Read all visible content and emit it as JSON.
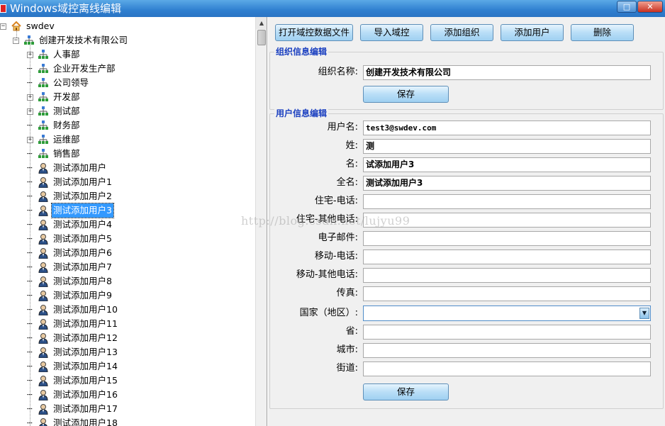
{
  "window": {
    "title": "Windows域控离线编辑",
    "maximize_glyph": "□",
    "close_glyph": "✕"
  },
  "tree": {
    "root": "swdev",
    "company": "创建开发技术有限公司",
    "departments": [
      {
        "label": "人事部",
        "expandable": true
      },
      {
        "label": "企业开发生产部",
        "expandable": false
      },
      {
        "label": "公司领导",
        "expandable": false
      },
      {
        "label": "开发部",
        "expandable": true
      },
      {
        "label": "测试部",
        "expandable": true
      },
      {
        "label": "财务部",
        "expandable": false
      },
      {
        "label": "运维部",
        "expandable": true
      },
      {
        "label": "销售部",
        "expandable": false
      }
    ],
    "users": [
      "测试添加用户",
      "测试添加用户1",
      "测试添加用户2",
      "测试添加用户3",
      "测试添加用户4",
      "测试添加用户5",
      "测试添加用户6",
      "测试添加用户7",
      "测试添加用户8",
      "测试添加用户9",
      "测试添加用户10",
      "测试添加用户11",
      "测试添加用户12",
      "测试添加用户13",
      "测试添加用户14",
      "测试添加用户15",
      "测试添加用户16",
      "测试添加用户17",
      "测试添加用户18"
    ],
    "selected_user": "测试添加用户3",
    "expand_glyph": "+"
  },
  "toolbar": {
    "open_data": "打开域控数据文件",
    "import": "导入域控",
    "add_org": "添加组织",
    "add_user": "添加用户",
    "delete": "删除"
  },
  "org_section": {
    "title": "组织信息编辑",
    "name_label": "组织名称:",
    "name_value": "创建开发技术有限公司",
    "save": "保存"
  },
  "user_section": {
    "title": "用户信息编辑",
    "fields": [
      {
        "label": "用户名:",
        "value": "test3@swdev.com"
      },
      {
        "label": "姓:",
        "value": "测"
      },
      {
        "label": "名:",
        "value": "试添加用户3"
      },
      {
        "label": "全名:",
        "value": "测试添加用户3"
      },
      {
        "label": "住宅-电话:",
        "value": ""
      },
      {
        "label": "住宅-其他电话:",
        "value": ""
      },
      {
        "label": "电子邮件:",
        "value": ""
      },
      {
        "label": "移动-电话:",
        "value": ""
      },
      {
        "label": "移动-其他电话:",
        "value": ""
      },
      {
        "label": "传真:",
        "value": ""
      }
    ],
    "country_label": "国家（地区）:",
    "country_value": "",
    "address_fields": [
      {
        "label": "省:",
        "value": ""
      },
      {
        "label": "城市:",
        "value": ""
      },
      {
        "label": "街道:",
        "value": ""
      }
    ],
    "save": "保存"
  },
  "watermark": "http://blog.csdn.net/lujyu99",
  "colors": {
    "titlebar": "#2f7fd0",
    "section_title": "#1a3fc0",
    "selection": "#3399ff"
  }
}
